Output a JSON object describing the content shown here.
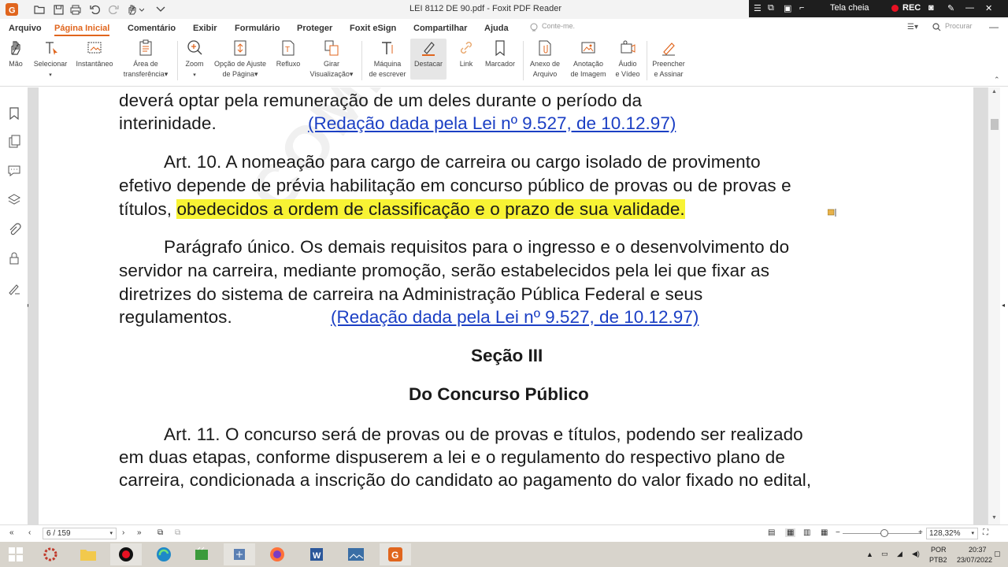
{
  "titlebar": {
    "document_title": "LEI 8112 DE 90.pdf - Foxit PDF Reader",
    "fullscreen_label": "Tela cheia",
    "rec_label": "REC"
  },
  "menu": {
    "items": [
      "Arquivo",
      "Página Inicial",
      "Comentário",
      "Exibir",
      "Formulário",
      "Proteger",
      "Foxit eSign",
      "Compartilhar",
      "Ajuda"
    ],
    "tell_me_placeholder": "Conte-me.",
    "search_placeholder": "Procurar"
  },
  "ribbon": {
    "mao": "Mão",
    "selecionar": "Selecionar",
    "instantaneo": "Instantâneo",
    "area_transferencia_1": "Área de",
    "area_transferencia_2": "transferência",
    "zoom": "Zoom",
    "opcao_ajuste_1": "Opção de Ajuste",
    "opcao_ajuste_2": "de Página",
    "refluxo": "Refluxo",
    "girar_1": "Girar",
    "girar_2": "Visualização",
    "maquina_1": "Máquina",
    "maquina_2": "de escrever",
    "destacar": "Destacar",
    "link": "Link",
    "marcador": "Marcador",
    "anexo_1": "Anexo de",
    "anexo_2": "Arquivo",
    "anotacao_1": "Anotação",
    "anotacao_2": "de Imagem",
    "audio_1": "Áudio",
    "audio_2": "e Vídeo",
    "preencher_1": "Preencher",
    "preencher_2": "e Assinar"
  },
  "document": {
    "line1": "deverá optar pela remuneração de um deles durante o período da",
    "line2": "interinidade.",
    "link1": "(Redação dada pela Lei nº 9.527, de 10.12.97)",
    "art10_l1": "Art. 10.  A nomeação para cargo de carreira ou cargo isolado de provimento",
    "art10_l2": "efetivo depende de prévia habilitação em concurso público de provas ou de provas e",
    "art10_l3_pre": "títulos, ",
    "art10_l3_hl": "obedecidos a ordem de classificação e o prazo de sua validade.",
    "par_l1": "Parágrafo único.  Os demais requisitos para o ingresso e o desenvolvimento do",
    "par_l2": "servidor na carreira, mediante promoção, serão estabelecidos pela lei que fixar as",
    "par_l3": "diretrizes do sistema de carreira na Administração Pública Federal e seus",
    "par_l4": "regulamentos.",
    "link2": "(Redação dada pela Lei nº 9.527, de 10.12.97)",
    "section": "Seção III",
    "subsection": "Do Concurso Público",
    "art11_l1": "Art. 11.  O concurso será de provas ou de provas e títulos, podendo ser realizado",
    "art11_l2": "em duas etapas, conforme dispuserem a lei e o regulamento do respectivo plano de",
    "art11_l3": "carreira, condicionada a inscrição do candidato ao pagamento do valor fixado no edital,",
    "watermark": "COMPARTILHAR PARA"
  },
  "statusbar": {
    "page": "6 / 159",
    "zoom": "128,32%"
  },
  "taskbar": {
    "lang1": "POR",
    "lang2": "PTB2",
    "time": "20:37",
    "date": "23/07/2022"
  },
  "colors": {
    "accent": "#e0651d",
    "highlight": "#f8f334",
    "link": "#1b3fc4"
  }
}
